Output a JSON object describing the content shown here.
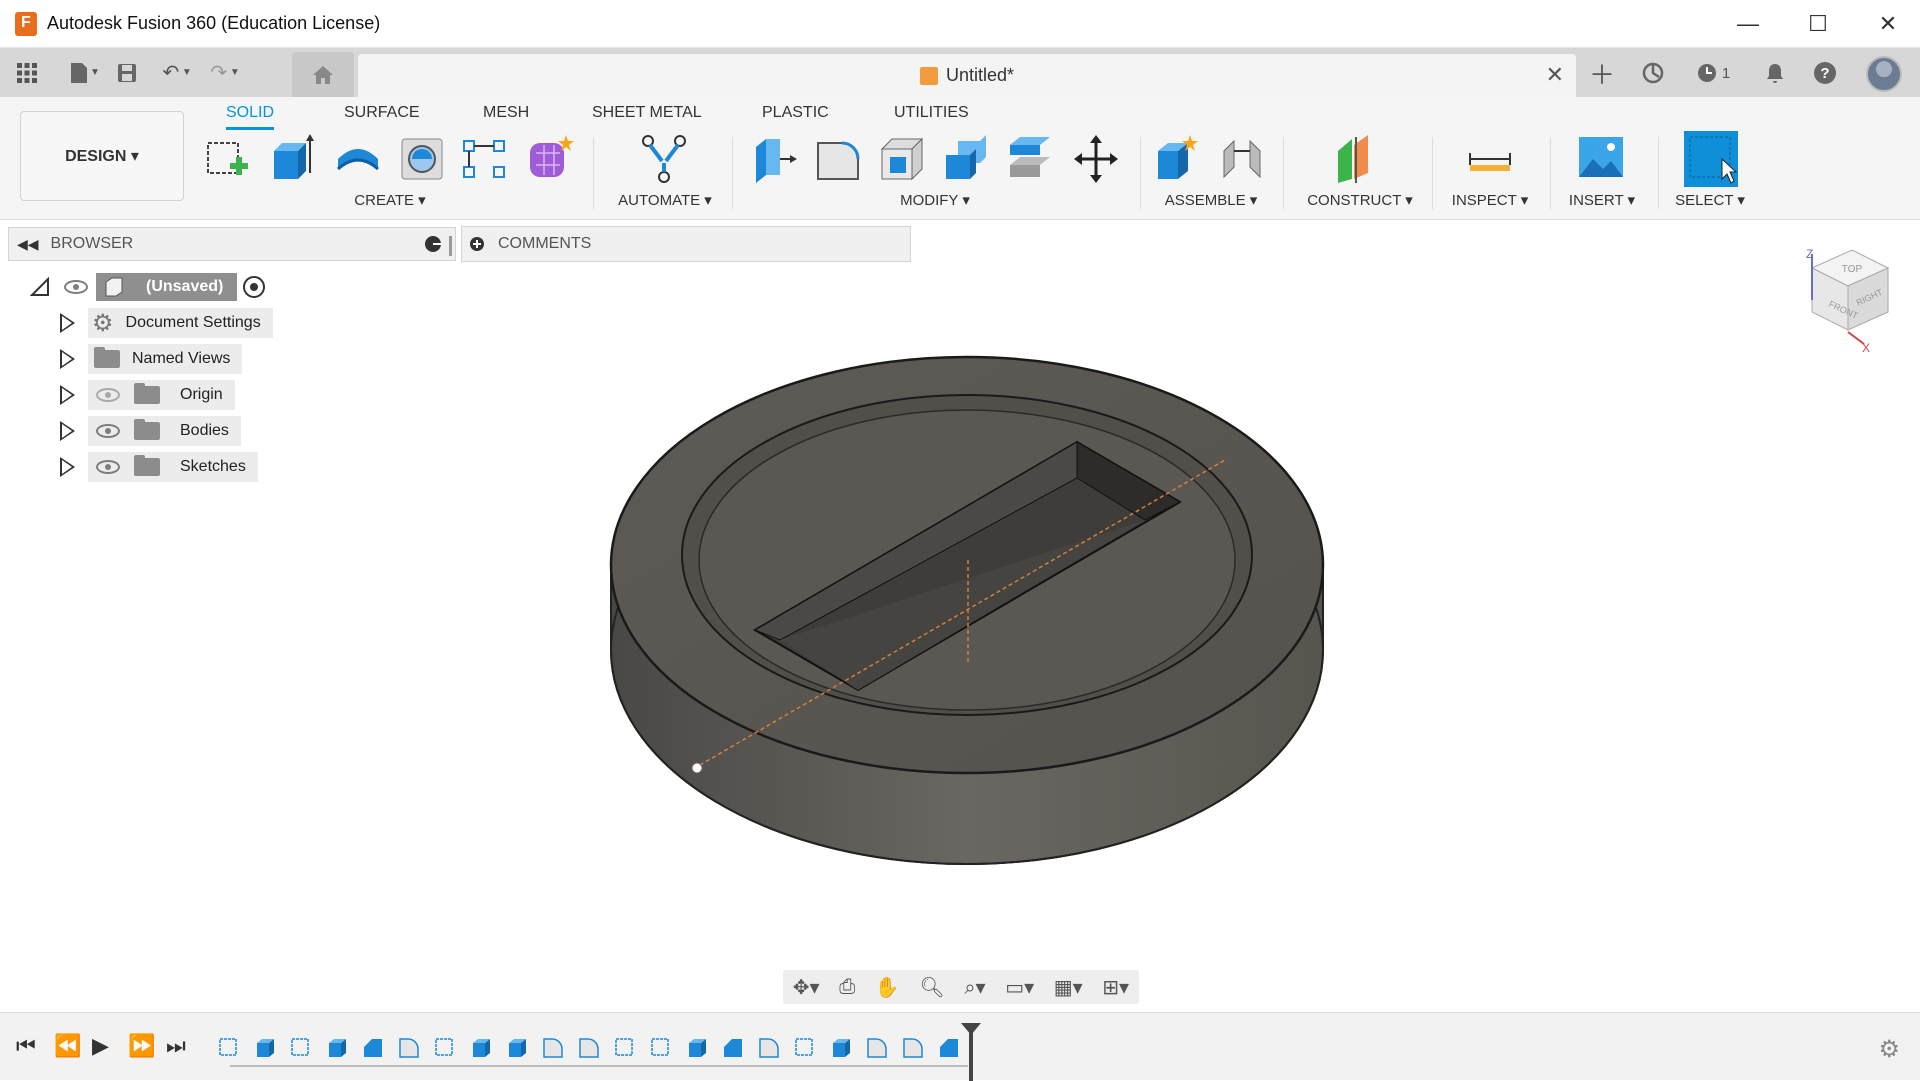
{
  "window": {
    "title": "Autodesk Fusion 360 (Education License)",
    "minimize": "—",
    "maximize": "☐",
    "close": "✕"
  },
  "quickaccess": {
    "doc_title": "Untitled*",
    "jobs_count": "1"
  },
  "workspace": {
    "label": "DESIGN ▾"
  },
  "tabs": [
    {
      "label": "SOLID",
      "active": true
    },
    {
      "label": "SURFACE"
    },
    {
      "label": "MESH"
    },
    {
      "label": "SHEET METAL"
    },
    {
      "label": "PLASTIC"
    },
    {
      "label": "UTILITIES"
    }
  ],
  "groups": [
    {
      "label": "CREATE ▾"
    },
    {
      "label": "AUTOMATE ▾"
    },
    {
      "label": "MODIFY ▾"
    },
    {
      "label": "ASSEMBLE ▾"
    },
    {
      "label": "CONSTRUCT ▾"
    },
    {
      "label": "INSPECT ▾"
    },
    {
      "label": "INSERT ▾"
    },
    {
      "label": "SELECT ▾"
    }
  ],
  "browser": {
    "title": "BROWSER",
    "root": "(Unsaved)",
    "items": [
      {
        "label": "Document Settings"
      },
      {
        "label": "Named Views"
      },
      {
        "label": "Origin"
      },
      {
        "label": "Bodies"
      },
      {
        "label": "Sketches"
      }
    ]
  },
  "comments": {
    "title": "COMMENTS"
  },
  "viewcube": {
    "top": "TOP",
    "front": "FRONT",
    "right": "RIGHT",
    "axis_z": "Z",
    "axis_x": "X"
  },
  "colors": {
    "accent": "#0696d7",
    "model": "#5a5753"
  }
}
